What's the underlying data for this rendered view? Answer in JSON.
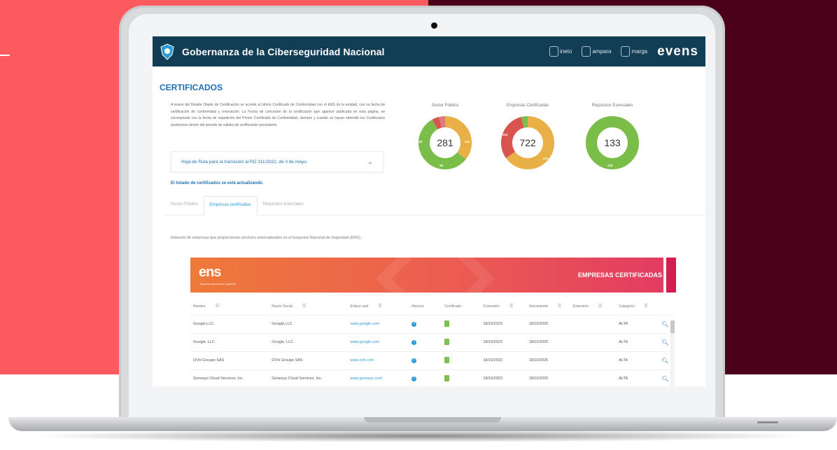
{
  "header": {
    "title": "Gobernanza de la Ciberseguridad Nacional",
    "partners": [
      "ineto",
      "ampara",
      "marga"
    ],
    "brand": "evens"
  },
  "page": {
    "title": "CERTIFICADOS",
    "intro": "A través del Detalle Objeto de Certificación se accede al último Certificado de Conformidad con el ENS de la entidad, con su fecha de certificación de conformidad y renovación. La Fecha de concesión de la certificación que aparece publicada en esta página, se corresponde con la fecha de expedición del Primer Certificado de Conformidad, siempre y cuando se hayan obtenido los Certificados posteriores dentro del periodo de validez de certificación precedente.",
    "accordion": "Hoja de Ruta para la transición al RD 311/2022, de 3 de mayo.",
    "updating": "El listado de certificados se está actualizando.",
    "relation": "Relación de empresas que proporcionan servicios externalizados en el Esquema Nacional de Seguridad (ENS)."
  },
  "tabs": [
    "Sector Público",
    "Empresas certificadas",
    "Requisitos esenciales"
  ],
  "charts": {
    "sector": {
      "label": "Sector Público",
      "total": "281",
      "seg_labels": [
        "100",
        "132",
        "26"
      ]
    },
    "empresas": {
      "label": "Empresas Certificadas",
      "total": "722",
      "seg_labels": [
        "222",
        "470"
      ]
    },
    "requisitos": {
      "label": "Requisitos Esenciales",
      "total": "133",
      "seg_labels": [
        "133"
      ]
    }
  },
  "banner": {
    "logo": "ens",
    "subtitle": "Esquema Nacional de Seguridad",
    "title": "EMPRESAS CERTIFICADAS"
  },
  "table": {
    "headers": [
      "Nombre",
      "Razón Social",
      "Enlace web",
      "Alcance",
      "Certificado",
      "Concesión",
      "Vencimiento",
      "Extensión",
      "Categoría"
    ],
    "rows": [
      {
        "nombre": "Google,LLC",
        "razon": "Google,LLC",
        "web": "www.google.com",
        "concesion": "18/10/2023",
        "vencimiento": "18/10/2025",
        "categoria": "ALTA"
      },
      {
        "nombre": "Google, LLC",
        "razon": "Google, LLC",
        "web": "www.google.com",
        "concesion": "18/10/2023",
        "vencimiento": "18/10/2025",
        "categoria": "ALTA"
      },
      {
        "nombre": "OVH Groupe SAS",
        "razon": "OVH Groupe SAS",
        "web": "www.ovh.com",
        "concesion": "18/10/2023",
        "vencimiento": "18/10/2025",
        "categoria": "ALTA"
      },
      {
        "nombre": "Genesys Cloud Services, Inc.",
        "razon": "Genesys Cloud Services, Inc.",
        "web": "www.genesys.com",
        "concesion": "18/10/2023",
        "vencimiento": "18/10/2025",
        "categoria": "ALTA"
      }
    ]
  },
  "chart_data": [
    {
      "type": "pie",
      "title": "Sector Público",
      "total": 281,
      "series": [
        {
          "values": [
            100,
            132,
            26,
            12,
            11
          ],
          "colors": [
            "#e9b048",
            "#7bbd49",
            "#7bbd49",
            "#d9534f",
            "#e07a7a"
          ]
        }
      ]
    },
    {
      "type": "pie",
      "title": "Empresas Certificadas",
      "total": 722,
      "series": [
        {
          "values": [
            470,
            222,
            19,
            11
          ],
          "colors": [
            "#e9b048",
            "#d9534f",
            "#7bbd49",
            "#7bbd49"
          ]
        }
      ]
    },
    {
      "type": "pie",
      "title": "Requisitos Esenciales",
      "total": 133,
      "series": [
        {
          "values": [
            133
          ],
          "colors": [
            "#7bbd49"
          ]
        }
      ]
    }
  ]
}
